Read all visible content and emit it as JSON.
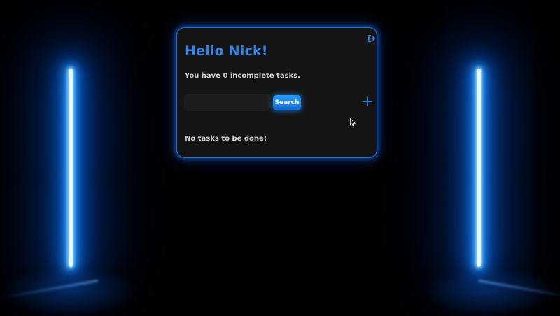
{
  "greeting": "Hello Nick!",
  "task_summary": "You have 0 incomplete tasks.",
  "search": {
    "placeholder": "",
    "value": "",
    "button_label": "Search"
  },
  "empty_message": "No tasks to be done!",
  "icons": {
    "logout": "logout-icon",
    "add": "plus-icon"
  },
  "colors": {
    "accent": "#2f86e8",
    "card_border": "#1d6fe0",
    "card_bg": "#141414",
    "neon": "#2a9bff"
  }
}
